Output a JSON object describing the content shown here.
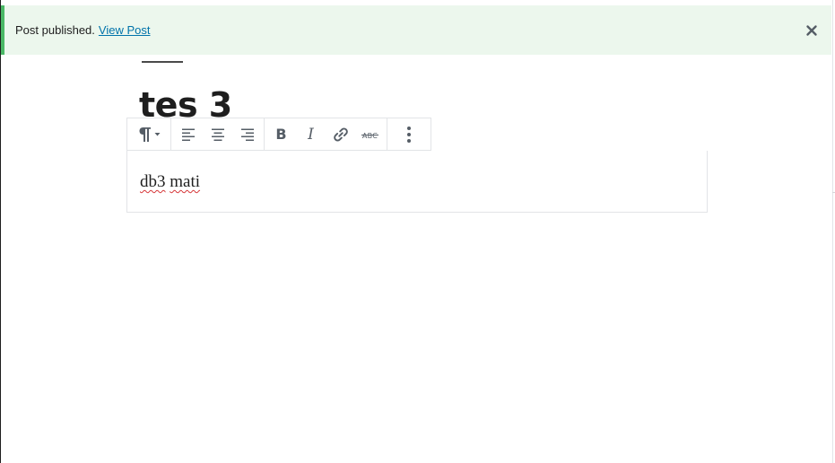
{
  "notice": {
    "message": "Post published.",
    "link_label": "View Post",
    "icons": {
      "close": "close-icon"
    },
    "colors": {
      "background": "#ecf7ed",
      "accent": "#4ab866",
      "link": "#0073aa"
    }
  },
  "editor": {
    "post_title": "tes 3",
    "paragraph": {
      "words": [
        "db3",
        "mati"
      ]
    }
  },
  "block_toolbar": {
    "groups": [
      {
        "name": "block-type",
        "icons": [
          "paragraph-icon",
          "chevron-down-icon"
        ]
      },
      {
        "name": "alignment",
        "icons": [
          "align-left-icon",
          "align-center-icon",
          "align-right-icon"
        ]
      },
      {
        "name": "formatting",
        "icons": [
          "bold-icon",
          "italic-icon",
          "link-icon",
          "strikethrough-icon"
        ]
      },
      {
        "name": "more",
        "icons": [
          "more-options-icon"
        ]
      }
    ],
    "labels": {
      "bold": "B",
      "italic": "I",
      "strikethrough": "ABC"
    }
  }
}
